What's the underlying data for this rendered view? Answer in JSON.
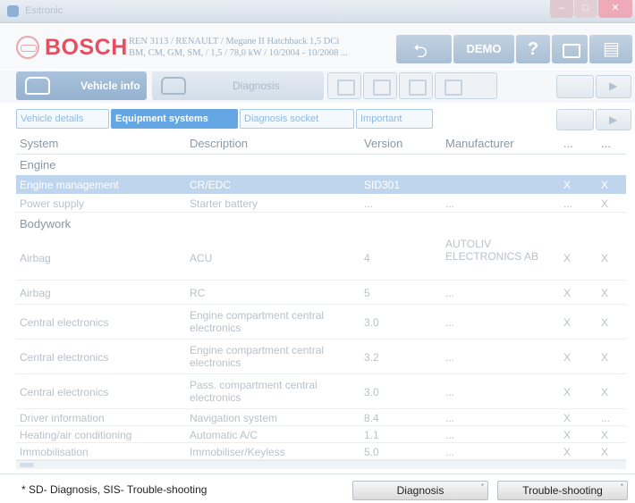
{
  "window": {
    "title": "Esitronic"
  },
  "header": {
    "brand": "BOSCH",
    "vehicle_line1": "REN 3113 / RENAULT / Megane II Hatchback 1,5 DCi",
    "vehicle_line2": "BM, CM, GM, SM, / 1,5 / 78,0 kW / 10/2004 - 10/2008 ...",
    "demo_label": "DEMO",
    "help_label": "?"
  },
  "main_tabs": {
    "vehicle_info": "Vehicle info",
    "diagnosis": "Diagnosis"
  },
  "sub_tabs": {
    "vehicle_details": "Vehicle details",
    "equipment_systems": "Equipment systems",
    "diagnosis_socket": "Diagnosis socket",
    "important": "Important"
  },
  "table": {
    "columns": [
      "System",
      "Description",
      "Version",
      "Manufacturer",
      "...",
      "..."
    ],
    "groups": [
      "Engine",
      "Bodywork"
    ],
    "rows": [
      {
        "system": "Engine management",
        "description": "CR/EDC",
        "version": "SID301",
        "manufacturer": "",
        "f1": "X",
        "f2": "X",
        "selected": true
      },
      {
        "system": "Power supply",
        "description": "Starter battery",
        "version": "...",
        "manufacturer": "...",
        "f1": "...",
        "f2": "X"
      },
      {
        "system": "Airbag",
        "description": "ACU",
        "version": "4",
        "manufacturer": "AUTOLIV ELECTRONICS AB",
        "f1": "X",
        "f2": "X"
      },
      {
        "system": "Airbag",
        "description": "RC",
        "version": "5",
        "manufacturer": "...",
        "f1": "X",
        "f2": "X"
      },
      {
        "system": "Central electronics",
        "description": "Engine compartment central electronics",
        "version": "3.0",
        "manufacturer": "...",
        "f1": "X",
        "f2": "X"
      },
      {
        "system": "Central electronics",
        "description": "Engine compartment central electronics",
        "version": "3.2",
        "manufacturer": "...",
        "f1": "X",
        "f2": "X"
      },
      {
        "system": "Central electronics",
        "description": "Pass. compartment central electronics",
        "version": "3.0",
        "manufacturer": "...",
        "f1": "X",
        "f2": "X"
      },
      {
        "system": "Driver information",
        "description": "Navigation system",
        "version": "8.4",
        "manufacturer": "...",
        "f1": "X",
        "f2": "..."
      },
      {
        "system": "Heating/air conditioning",
        "description": "Automatic A/C",
        "version": "1.1",
        "manufacturer": "...",
        "f1": "X",
        "f2": "X"
      },
      {
        "system": "Immobilisation",
        "description": "Immobiliser/Keyless",
        "version": "5.0",
        "manufacturer": "...",
        "f1": "X",
        "f2": "X"
      }
    ]
  },
  "footer": {
    "footnote": "* SD- Diagnosis, SIS- Trouble-shooting",
    "diagnosis_button": "Diagnosis",
    "troubleshooting_button": "Trouble-shooting",
    "superscript": "*"
  },
  "colors": {
    "brand_red": "#e64f62",
    "tab_active": "#64a6e4",
    "row_selected": "#bfd5ee"
  }
}
